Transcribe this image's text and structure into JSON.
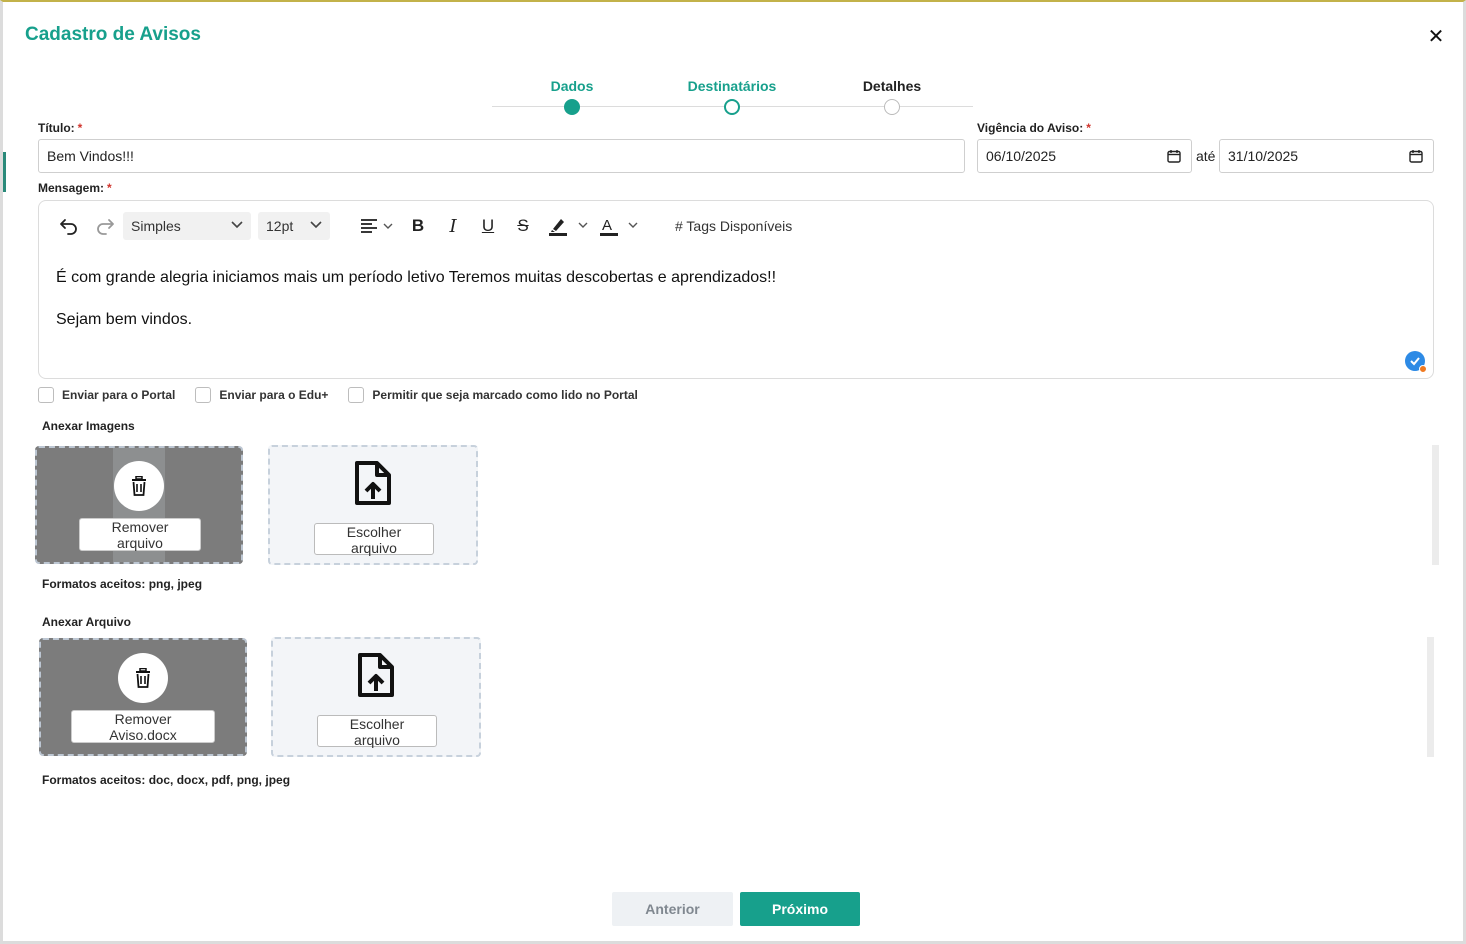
{
  "dialog": {
    "title": "Cadastro de Avisos"
  },
  "stepper": {
    "steps": [
      {
        "label": "Dados",
        "state": "completed"
      },
      {
        "label": "Destinatários",
        "state": "active"
      },
      {
        "label": "Detalhes",
        "state": "pending"
      }
    ]
  },
  "form": {
    "title_label": "Título:",
    "title_value": "Bem Vindos!!!",
    "required_mark": "*",
    "validity_label": "Vigência do Aviso:",
    "date_from": "06/10/2025",
    "date_separator": "até",
    "date_to": "31/10/2025",
    "message_label": "Mensagem:"
  },
  "editor": {
    "block_format": "Simples",
    "font_size": "12pt",
    "tags_label": "# Tags Disponíveis",
    "paragraphs": [
      "É com grande alegria iniciamos mais um período letivo Teremos muitas descobertas e aprendizados!!",
      "Sejam bem vindos."
    ]
  },
  "options": {
    "send_portal": "Enviar para o Portal",
    "send_edu": "Enviar para o Edu+",
    "mark_read": "Permitir que seja marcado como lido no Portal"
  },
  "images": {
    "label": "Anexar Imagens",
    "remove_label": "Remover arquivo",
    "choose_label": "Escolher arquivo",
    "formats": "Formatos aceitos: png, jpeg"
  },
  "files": {
    "label": "Anexar Arquivo",
    "remove_label": "Remover Aviso.docx",
    "choose_label": "Escolher arquivo",
    "formats": "Formatos aceitos: doc, docx, pdf, png, jpeg"
  },
  "footer": {
    "prev_label": "Anterior",
    "next_label": "Próximo"
  },
  "colors": {
    "accent": "#17a08c",
    "required": "#d0342c"
  }
}
